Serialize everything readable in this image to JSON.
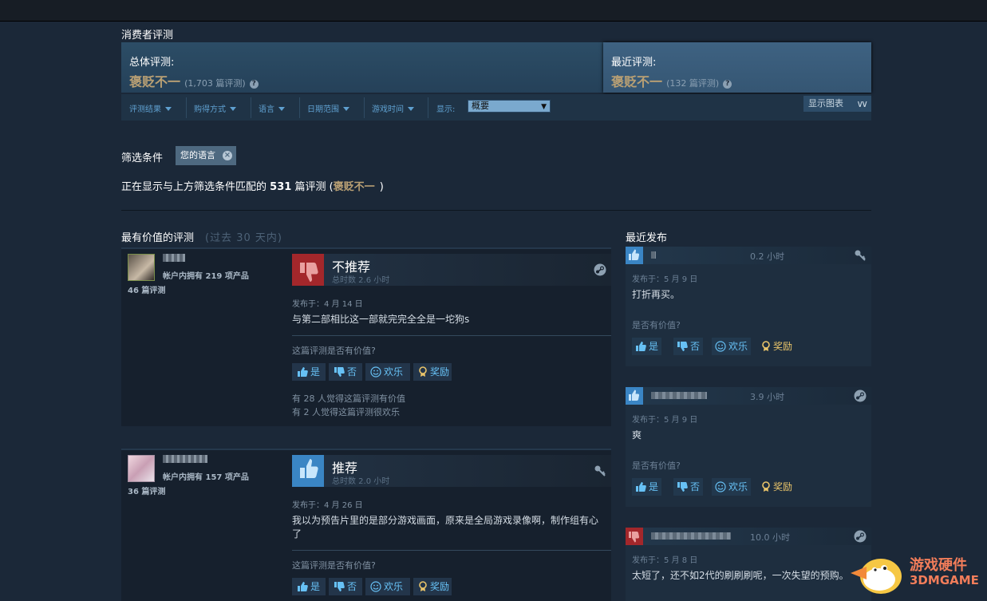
{
  "section_title": "消费者评测",
  "summary": {
    "overall_label": "总体评测:",
    "overall_rating": "褒贬不一",
    "overall_count": "(1,703 篇评测)",
    "recent_label": "最近评测:",
    "recent_rating": "褒贬不一",
    "recent_count": "(132 篇评测)",
    "help_glyph": "?"
  },
  "filters": {
    "items": [
      "评测结果",
      "购得方式",
      "语言",
      "日期范围",
      "游戏时间"
    ],
    "display_label": "显示:",
    "display_value": "概要",
    "show_chart": "显示图表"
  },
  "active_filters": {
    "label": "筛选条件",
    "chip": "您的语言",
    "chip_close": "×"
  },
  "showing": {
    "prefix": "正在显示与上方筛选条件匹配的",
    "count": "531",
    "suffix": "篇评测",
    "paren_open": "(",
    "rating": "褒贬不一",
    "paren_close": ")"
  },
  "helpful": {
    "title": "最有价值的评测",
    "subtitle": "(过去 30 天内)"
  },
  "recent_title": "最近发布",
  "buttons": {
    "yes": "是",
    "no": "否",
    "funny": "欢乐",
    "award": "奖励"
  },
  "reviews": [
    {
      "owned": "帐户内拥有 219 项产品",
      "num_reviews": "46 篇评测",
      "verdict": "不推荐",
      "hours": "总时数 2.6 小时",
      "posted": "发布于：4 月 14 日",
      "text": "与第二部相比这一部就完完全全是一坨狗s",
      "helpful_q": "这篇评测是否有价值?",
      "stat1": "有 28 人觉得这篇评测有价值",
      "stat2": "有 2 人觉得这篇评测很欢乐"
    },
    {
      "owned": "帐户内拥有 157 项产品",
      "num_reviews": "36 篇评测",
      "verdict": "推荐",
      "hours": "总时数 2.0 小时",
      "posted": "发布于：4 月 26 日",
      "text": "我以为预告片里的是部分游戏画面，原来是全局游戏录像啊，制作组有心了",
      "helpful_q": "这篇评测是否有价值?"
    }
  ],
  "recent": [
    {
      "hours": "0.2 小时",
      "posted": "发布于：5 月 9 日",
      "text": "打折再买。",
      "q": "是否有价值?"
    },
    {
      "hours": "3.9 小时",
      "posted": "发布于：5 月 9 日",
      "text": "爽",
      "q": "是否有价值?"
    },
    {
      "hours": "10.0 小时",
      "posted": "发布于：5 月 8 日",
      "text": "太短了，还不如2代的刷刷刷呢，一次失望的预购。"
    }
  ],
  "watermark": {
    "cn": "游戏硬件",
    "en": "3DMGAME"
  },
  "colors": {
    "background": "#1b2838",
    "mixed": "#b9a074",
    "link": "#67c1f5",
    "not_recommended": "#a3272b",
    "recommended": "#3a85c4"
  }
}
